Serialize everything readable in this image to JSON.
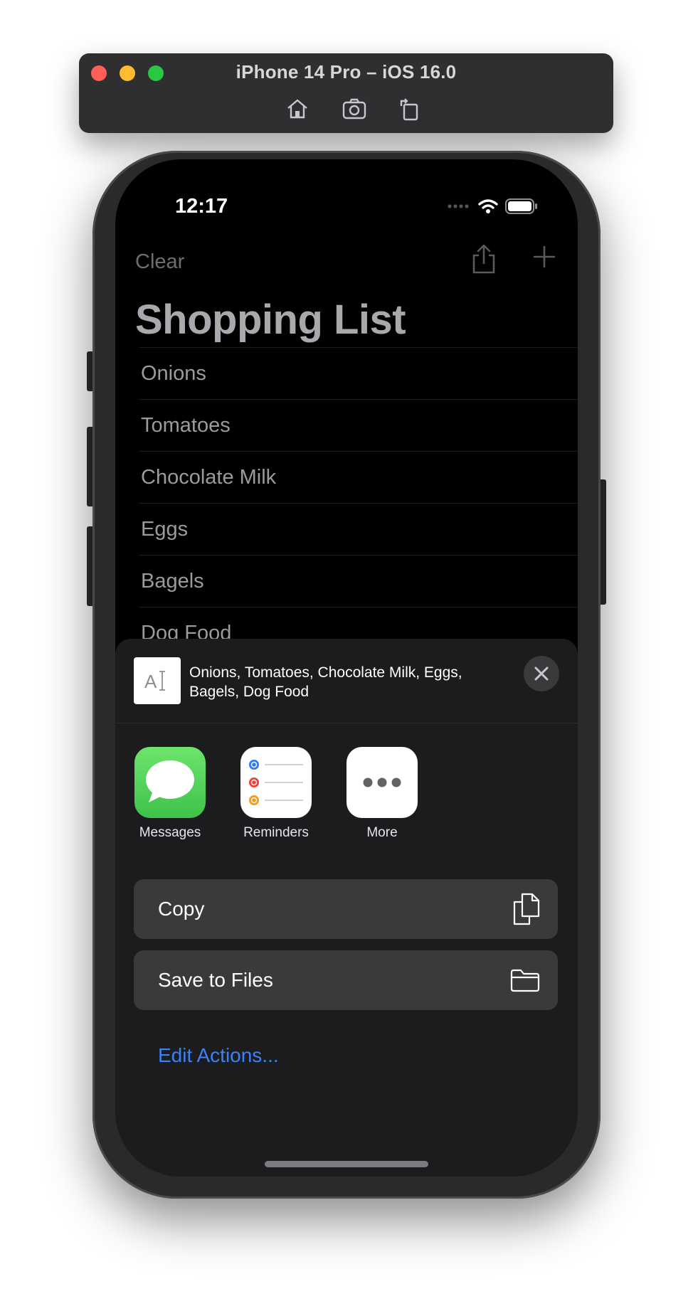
{
  "simulator": {
    "title": "iPhone 14 Pro – iOS 16.0",
    "toolbar_icons": [
      "home-icon",
      "screenshot-icon",
      "rotate-icon"
    ]
  },
  "status_bar": {
    "time": "12:17",
    "icons": [
      "cellular-icon",
      "wifi-icon",
      "battery-icon"
    ]
  },
  "nav": {
    "clear_label": "Clear",
    "share_icon": "share-icon",
    "add_icon": "plus-icon"
  },
  "page": {
    "title": "Shopping List"
  },
  "list": {
    "items": [
      "Onions",
      "Tomatoes",
      "Chocolate Milk",
      "Eggs",
      "Bagels",
      "Dog Food"
    ]
  },
  "share_sheet": {
    "preview_text": "Onions, Tomatoes, Chocolate Milk, Eggs, Bagels, Dog Food",
    "apps": [
      {
        "label": "Messages",
        "icon": "messages-icon"
      },
      {
        "label": "Reminders",
        "icon": "reminders-icon"
      },
      {
        "label": "More",
        "icon": "more-icon"
      }
    ],
    "actions": [
      {
        "label": "Copy",
        "icon": "copy-icon"
      },
      {
        "label": "Save to Files",
        "icon": "folder-icon"
      }
    ],
    "edit_actions_label": "Edit Actions..."
  },
  "colors": {
    "accent": "#3a82f7",
    "sheet_background": "#1c1c1e",
    "action_background": "#3a3a3c"
  }
}
